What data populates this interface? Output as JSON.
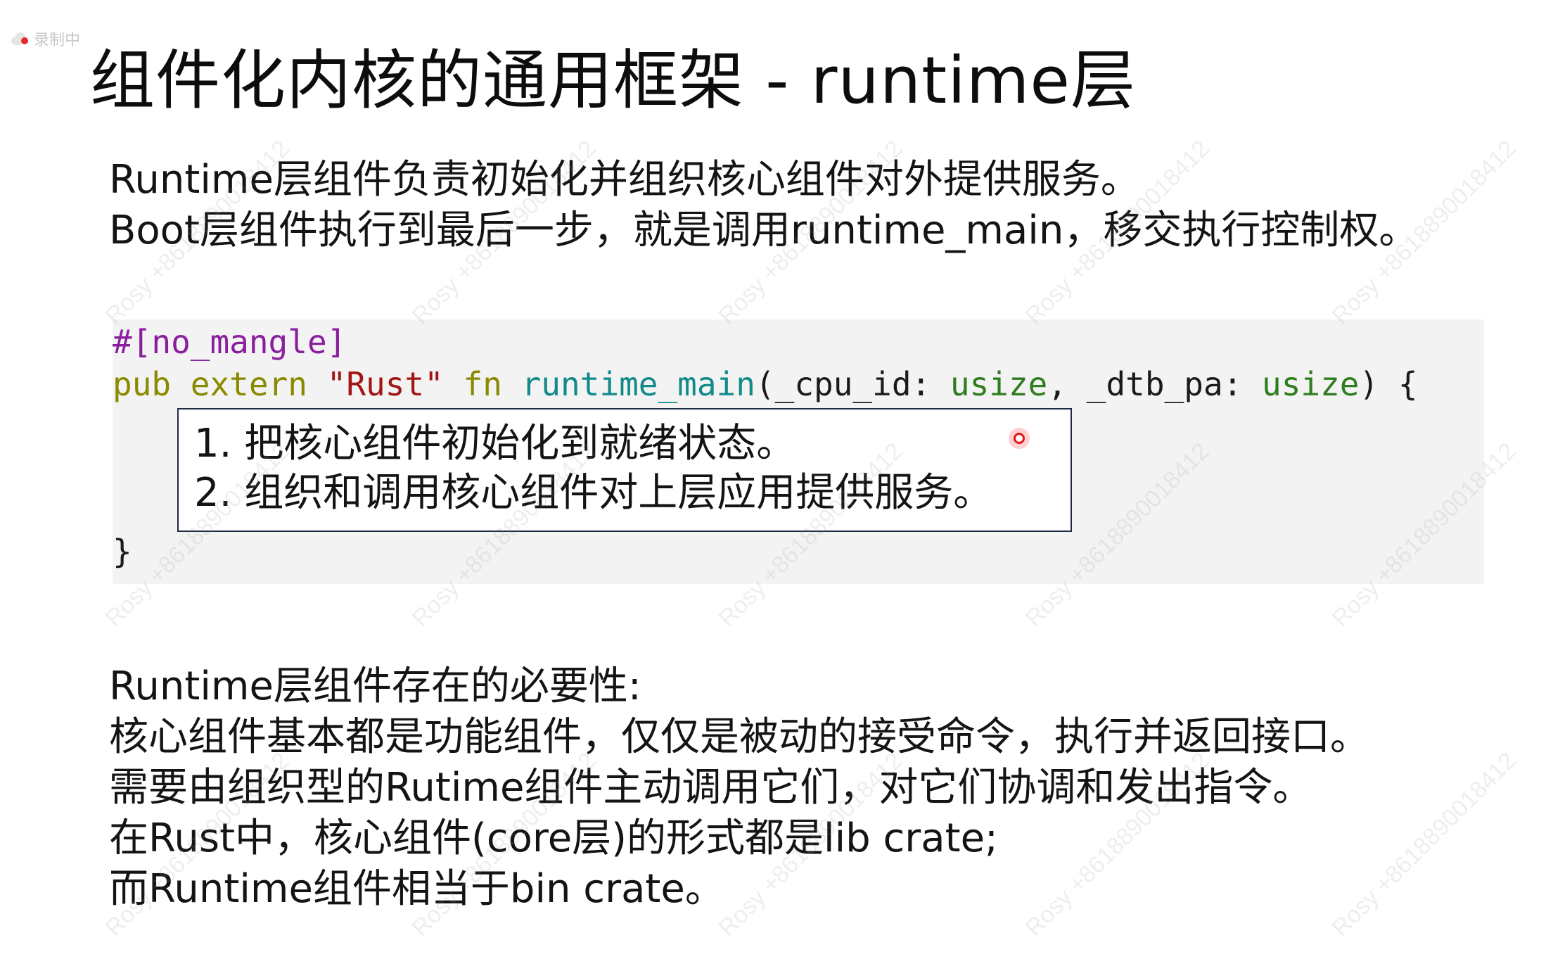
{
  "recording_badge": {
    "label": "录制中",
    "icon": "recording-cloud-icon"
  },
  "slide": {
    "title": "组件化内核的通用框架 - runtime层",
    "intro_lines": [
      "Runtime层组件负责初始化并组织核心组件对外提供服务。",
      "Boot层组件执行到最后一步，就是调用runtime_main，移交执行控制权。"
    ],
    "code": {
      "attr": "#[no_mangle]",
      "sig_pub": "pub",
      "sig_extern": " extern ",
      "sig_abi": "\"Rust\"",
      "sig_fn": " fn ",
      "sig_name": "runtime_main",
      "sig_p1": "(_cpu_id: ",
      "sig_t1": "usize",
      "sig_p2": ", _dtb_pa: ",
      "sig_t2": "usize",
      "sig_end": ") {",
      "close": "}"
    },
    "callout_lines": [
      "1. 把核心组件初始化到就绪状态。",
      "2. 组织和调用核心组件对上层应用提供服务。"
    ],
    "necessity_lines": [
      "Runtime层组件存在的必要性:",
      "核心组件基本都是功能组件，仅仅是被动的接受命令，执行并返回接口。",
      "需要由组织型的Rutime组件主动调用它们，对它们协调和发出指令。",
      "在Rust中，核心组件(core层)的形式都是lib crate;",
      "而Runtime组件相当于bin crate。"
    ]
  },
  "watermark_text": "Rosy +8618890018412",
  "colors": {
    "attr": "#8a1f9e",
    "keyword": "#8a8a00",
    "string": "#a31515",
    "function": "#138a8a",
    "type": "#2f7d1f",
    "code_bg": "#f3f3f3",
    "callout_border": "#1f2b44"
  }
}
